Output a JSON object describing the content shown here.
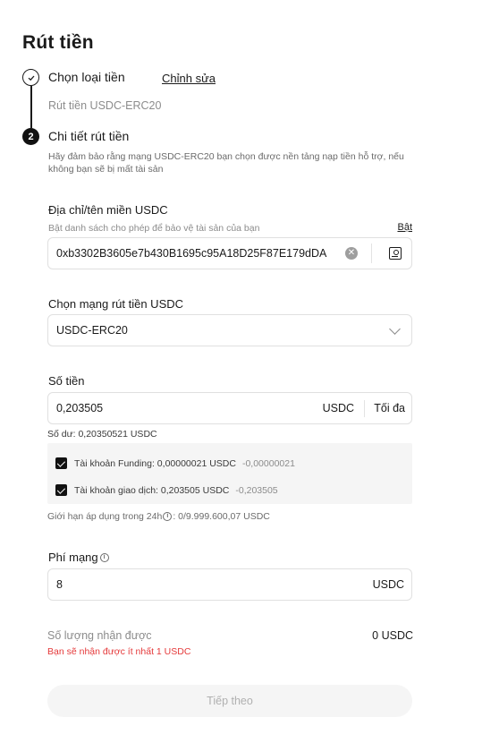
{
  "page": {
    "title": "Rút tiền"
  },
  "steps": {
    "step1": {
      "label": "Chọn loại tiền",
      "edit_label": "Chỉnh sửa",
      "selected": "Rút tiền USDC-ERC20"
    },
    "step2": {
      "number": "2",
      "label": "Chi tiết rút tiền",
      "notice": "Hãy đảm bảo rằng mạng USDC-ERC20 bạn chọn được nền tảng nạp tiền hỗ trợ, nếu không bạn sẽ bị mất tài sản"
    }
  },
  "address": {
    "label": "Địa chỉ/tên miền USDC",
    "whitelist_hint": "Bật danh sách cho phép để bảo vệ tài sản của bạn",
    "whitelist_toggle": "Bật",
    "value": "0xb3302B3605e7b430B1695c95A18D25F87E179dDA",
    "clear_icon": "clear-circle-icon",
    "address_book_icon": "address-book-icon"
  },
  "network": {
    "label": "Chọn mạng rút tiền USDC",
    "selected": "USDC-ERC20",
    "chevron_icon": "chevron-down-icon"
  },
  "amount": {
    "label": "Số tiền",
    "value": "0,203505",
    "unit": "USDC",
    "max_label": "Tối đa",
    "balance": "Số dư: 0,20350521 USDC"
  },
  "accounts": [
    {
      "name": "Tài khoản Funding: 0,00000021 USDC",
      "delta": "-0,00000021",
      "checked": true
    },
    {
      "name": "Tài khoản giao dịch: 0,203505 USDC",
      "delta": "-0,203505",
      "checked": true
    }
  ],
  "limit": {
    "prefix": "Giới hạn áp dụng trong 24h",
    "suffix": ": 0/9.999.600,07 USDC"
  },
  "fee": {
    "label": "Phí mạng",
    "value": "8",
    "unit": "USDC"
  },
  "receive": {
    "label": "Số lượng nhận được",
    "value": "0 USDC",
    "warning": "Bạn sẽ nhận được ít nhất 1 USDC"
  },
  "actions": {
    "next_label": "Tiếp theo"
  },
  "colors": {
    "primary_text": "#1a1a1a",
    "secondary_text": "#8c8c8c",
    "warning": "#e5393a",
    "disabled_bg": "#f5f5f5",
    "disabled_text": "#b0b0b0"
  }
}
